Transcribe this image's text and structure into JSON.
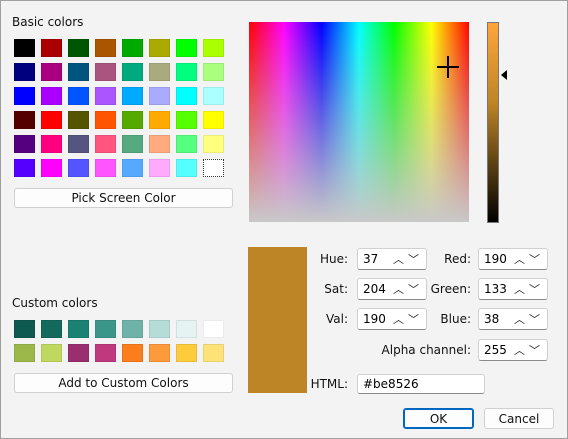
{
  "dialog": {
    "basic_colors_label": "Basic colors",
    "custom_colors_label": "Custom colors",
    "pick_screen_color": "Pick Screen Color",
    "add_to_custom": "Add to Custom Colors",
    "ok": "OK",
    "cancel": "Cancel"
  },
  "basic_colors": [
    "#000000",
    "#aa0000",
    "#005500",
    "#aa5500",
    "#00aa00",
    "#aaaa00",
    "#00ff00",
    "#aaff00",
    "#00007f",
    "#aa007f",
    "#00557f",
    "#aa557f",
    "#00aa7f",
    "#aaaa7f",
    "#00ff7f",
    "#aaff7f",
    "#0000ff",
    "#aa00ff",
    "#0055ff",
    "#aa55ff",
    "#00aaff",
    "#aaaaff",
    "#00ffff",
    "#aaffff",
    "#550000",
    "#ff0000",
    "#555500",
    "#ff5500",
    "#55aa00",
    "#ffaa00",
    "#55ff00",
    "#ffff00",
    "#55007f",
    "#ff007f",
    "#55557f",
    "#ff557f",
    "#55aa7f",
    "#ffaa7f",
    "#55ff7f",
    "#ffff7f",
    "#5500ff",
    "#ff00ff",
    "#5555ff",
    "#ff55ff",
    "#55aaff",
    "#ffaaff",
    "#55ffff",
    "#ffffff"
  ],
  "custom_colors": [
    "#0f5a50",
    "#12695c",
    "#1a8173",
    "#3b968a",
    "#6fb2aa",
    "#b6dcd7",
    "#e5f4f2",
    "#ffffff",
    "#9db84a",
    "#c0d760",
    "#9b2e6e",
    "#c0397f",
    "#fb7d1c",
    "#fd9a3b",
    "#fccc3c",
    "#fde27a"
  ],
  "fields": {
    "hue": {
      "label": "Hue:",
      "value": "37"
    },
    "sat": {
      "label": "Sat:",
      "value": "204"
    },
    "val": {
      "label": "Val:",
      "value": "190"
    },
    "red": {
      "label": "Red:",
      "value": "190"
    },
    "green": {
      "label": "Green:",
      "value": "133"
    },
    "blue": {
      "label": "Blue:",
      "value": "38"
    },
    "alpha": {
      "label": "Alpha channel:",
      "value": "255"
    },
    "html": {
      "label": "HTML:",
      "value": "#be8526"
    }
  },
  "current_color": "#be8526"
}
